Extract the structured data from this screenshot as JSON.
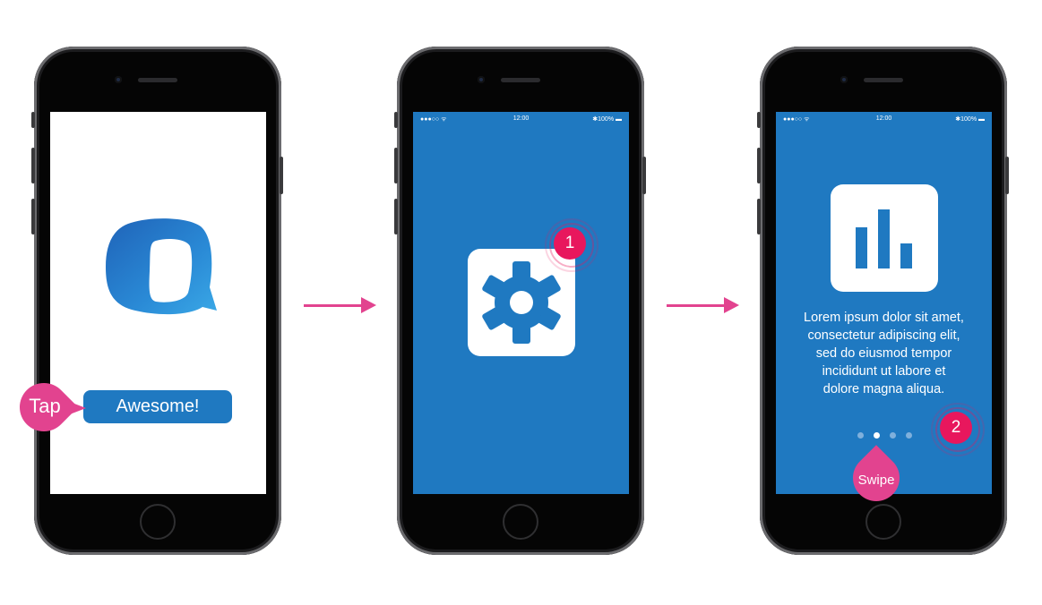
{
  "colors": {
    "primary_blue": "#1f79c1",
    "accent_pink": "#e2438f",
    "badge_red": "#e8175d"
  },
  "screen1": {
    "button_label": "Awesome!",
    "gesture_label": "Tap",
    "logo_icon": "chat-bubble-logo-icon"
  },
  "screen2": {
    "status_time": "12:00",
    "status_battery": "100%",
    "icon": "settings-gear-icon",
    "badge_number": "1"
  },
  "screen3": {
    "status_time": "12:00",
    "status_battery": "100%",
    "icon": "bar-chart-icon",
    "body_text": "Lorem ipsum dolor sit amet, consectetur adipiscing elit, sed do eiusmod tempor incididunt ut labore et dolore magna aliqua.",
    "badge_number": "2",
    "gesture_label": "Swipe",
    "page_indicator": {
      "count": 4,
      "active_index": 1
    }
  }
}
